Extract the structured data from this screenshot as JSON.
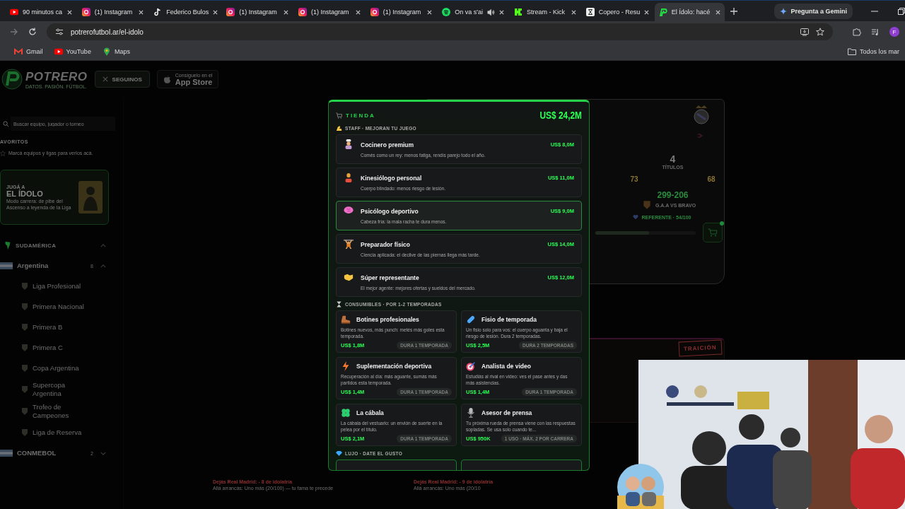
{
  "browser": {
    "tabs": [
      {
        "title": "90 minutos ca",
        "kind": "youtube",
        "audio": false,
        "selected": false
      },
      {
        "title": "(1) Instagram",
        "kind": "instagram",
        "audio": false,
        "selected": false
      },
      {
        "title": "Federico Bulos",
        "kind": "tiktok",
        "audio": false,
        "selected": false
      },
      {
        "title": "(1) Instagram",
        "kind": "instagram",
        "audio": false,
        "selected": false
      },
      {
        "title": "(1) Instagram",
        "kind": "instagram",
        "audio": false,
        "selected": false
      },
      {
        "title": "(1) Instagram",
        "kind": "instagram",
        "audio": false,
        "selected": false
      },
      {
        "title": "On va s'ai",
        "kind": "spotify",
        "audio": true,
        "selected": false
      },
      {
        "title": "Stream - Kick",
        "kind": "kick",
        "audio": false,
        "selected": false
      },
      {
        "title": "Copero - Resu",
        "kind": "copero",
        "audio": false,
        "selected": false
      },
      {
        "title": "El Ídolo: hacé",
        "kind": "potrero",
        "audio": false,
        "selected": true
      }
    ],
    "gemini_button": "Pregunta a Gemini",
    "url": "potrerofutbol.ar/el-idolo",
    "profile_initial": "F",
    "bookmarks": [
      {
        "label": "Gmail",
        "kind": "gmail"
      },
      {
        "label": "YouTube",
        "kind": "youtube"
      },
      {
        "label": "Maps",
        "kind": "maps"
      }
    ],
    "all_bookmarks": "Todos los mar"
  },
  "header": {
    "logo": "POTRERO",
    "tagline": "DATOS. PASIÓN. FÚTBOL.",
    "follow_button": "SEGUINOS",
    "app_store": {
      "small": "Consíguelo en el",
      "big": "App Store"
    }
  },
  "sidebar": {
    "search": {
      "placeholder": "Buscar equipo, jugador o torneo"
    },
    "favorites_heading": "AVORITOS",
    "favorites_hint": "Marcá equipos y ligas para verlos acá.",
    "promo": {
      "kicker": "JUGÁ A",
      "title": "EL ÍDOLO",
      "text": "Modo carrera: de pibe del Ascenso a leyenda de la Liga"
    },
    "tree": [
      {
        "label": "SUDAMÉRICA",
        "expanded": true,
        "children": [
          {
            "label": "Argentina",
            "count": "8",
            "expanded": true,
            "children": [
              {
                "label": "Liga Profesional"
              },
              {
                "label": "Primera Nacional"
              },
              {
                "label": "Primera B"
              },
              {
                "label": "Primera C"
              },
              {
                "label": "Copa Argentina"
              },
              {
                "label": "Supercopa Argentina"
              },
              {
                "label": "Trofeo de Campeones"
              },
              {
                "label": "Liga de Reserva"
              }
            ]
          },
          {
            "label": "CONMEBOL",
            "count": "2",
            "expanded": false
          }
        ]
      }
    ]
  },
  "career_card": {
    "titles": "4",
    "titles_label": "TÍTULOS",
    "stat_1": "73",
    "stat_2": "68",
    "record": "299-206",
    "match": "G.A.A VS BRAVO",
    "status": "REFERENTE · 54/100",
    "idolatry": {
      "level": 0.54
    },
    "cart_alert": true
  },
  "offer_card": {
    "badge": "TRAICIÓN"
  },
  "offer_texts": [
    {
      "line_1": "Dejás Real Madrid: - 8 de idolatría",
      "line_2": "Allá arrancás: Uno más (20/100) — tu fama te precede"
    },
    {
      "line_1": "Dejás Real Madrid: - 9 de idolatría",
      "line_2": "Allá arrancás: Uno más (20/10"
    }
  ],
  "shop": {
    "title": "TIENDA",
    "balance": "US$ 24,2M",
    "sections": [
      {
        "kind": "list",
        "title": "STAFF · MEJORAN TU JUEGO",
        "items": [
          {
            "name": "Cocinero premium",
            "desc": "Comés como un rey: menos fatiga, rendís parejo todo el año.",
            "price": "US$ 8,0M",
            "selected": false
          },
          {
            "name": "Kinesiólogo personal",
            "desc": "Cuerpo blindado: menos riesgo de lesión.",
            "price": "US$ 11,0M",
            "selected": false
          },
          {
            "name": "Psicólogo deportivo",
            "desc": "Cabeza fría: la mala racha te dura menos.",
            "price": "US$ 9,0M",
            "selected": true
          },
          {
            "name": "Preparador físico",
            "desc": "Ciencia aplicada: el declive de las piernas llega más tarde.",
            "price": "US$ 14,0M",
            "selected": false
          },
          {
            "name": "Súper representante",
            "desc": "El mejor agente: mejores ofertas y sueldos del mercado.",
            "price": "US$ 12,0M",
            "selected": false
          }
        ]
      },
      {
        "kind": "grid",
        "title": "CONSUMIBLES · POR 1-2 TEMPORADAS",
        "items": [
          {
            "name": "Botines profesionales",
            "desc": "Botines nuevos, más punch: metés más goles esta temporada.",
            "price": "US$ 1,8M",
            "duration": "DURA 1 TEMPORADA"
          },
          {
            "name": "Fisio de temporada",
            "desc": "Un fisio solo para vos: el cuerpo aguanta y baja el riesgo de lesión. Dura 2 temporadas.",
            "price": "US$ 2,5M",
            "duration": "DURA 2 TEMPORADAS"
          },
          {
            "name": "Suplementación deportiva",
            "desc": "Recuperación al día: más aguante, sumás más partidos esta temporada.",
            "price": "US$ 1,4M",
            "duration": "DURA 1 TEMPORADA"
          },
          {
            "name": "Analista de video",
            "desc": "Estudiás al rival en video: ves el pase antes y das más asistencias.",
            "price": "US$ 1,4M",
            "duration": "DURA 1 TEMPORADA"
          },
          {
            "name": "La cábala",
            "desc": "La cábala del vestuario: un envión de suerte en la pelea por el título.",
            "price": "US$ 2,1M",
            "duration": "DURA 1 TEMPORADA"
          },
          {
            "name": "Asesor de prensa",
            "desc": "Tu próxima rueda de prensa viene con las respuestas sopladas. Se usa solo cuando te...",
            "price": "US$ 950K",
            "duration": "1 USO · MÁX. 2 POR CARRERA"
          }
        ]
      },
      {
        "kind": "teaser",
        "title": "LUJO · DATE EL GUSTO"
      }
    ]
  }
}
